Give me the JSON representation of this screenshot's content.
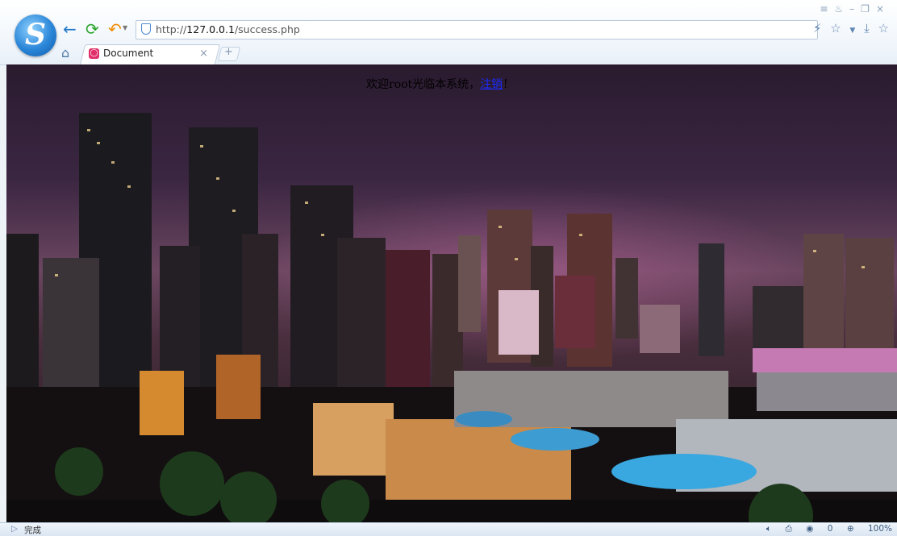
{
  "browser": {
    "logo_letter": "S",
    "url_prefix": "http://",
    "url_host": "127.0.0.1",
    "url_path": "/success.php",
    "tab_title": "Document",
    "new_tab_symbol": "+",
    "close_symbol": "×"
  },
  "page": {
    "welcome_prefix": "欢迎root光临本系统，",
    "logout_link": "注销",
    "welcome_suffix": "！"
  },
  "status": {
    "text": "完成",
    "counter": "0",
    "zoom": "100%"
  },
  "icons": {
    "back": "back-arrow-icon",
    "refresh": "refresh-icon",
    "undo": "undo-icon",
    "home": "home-icon",
    "security": "shield-icon",
    "favorite": "star-icon",
    "download": "download-icon",
    "lightning": "lightning-icon"
  },
  "colors": {
    "link": "#1a2cff",
    "accent": "#2a86d8"
  }
}
